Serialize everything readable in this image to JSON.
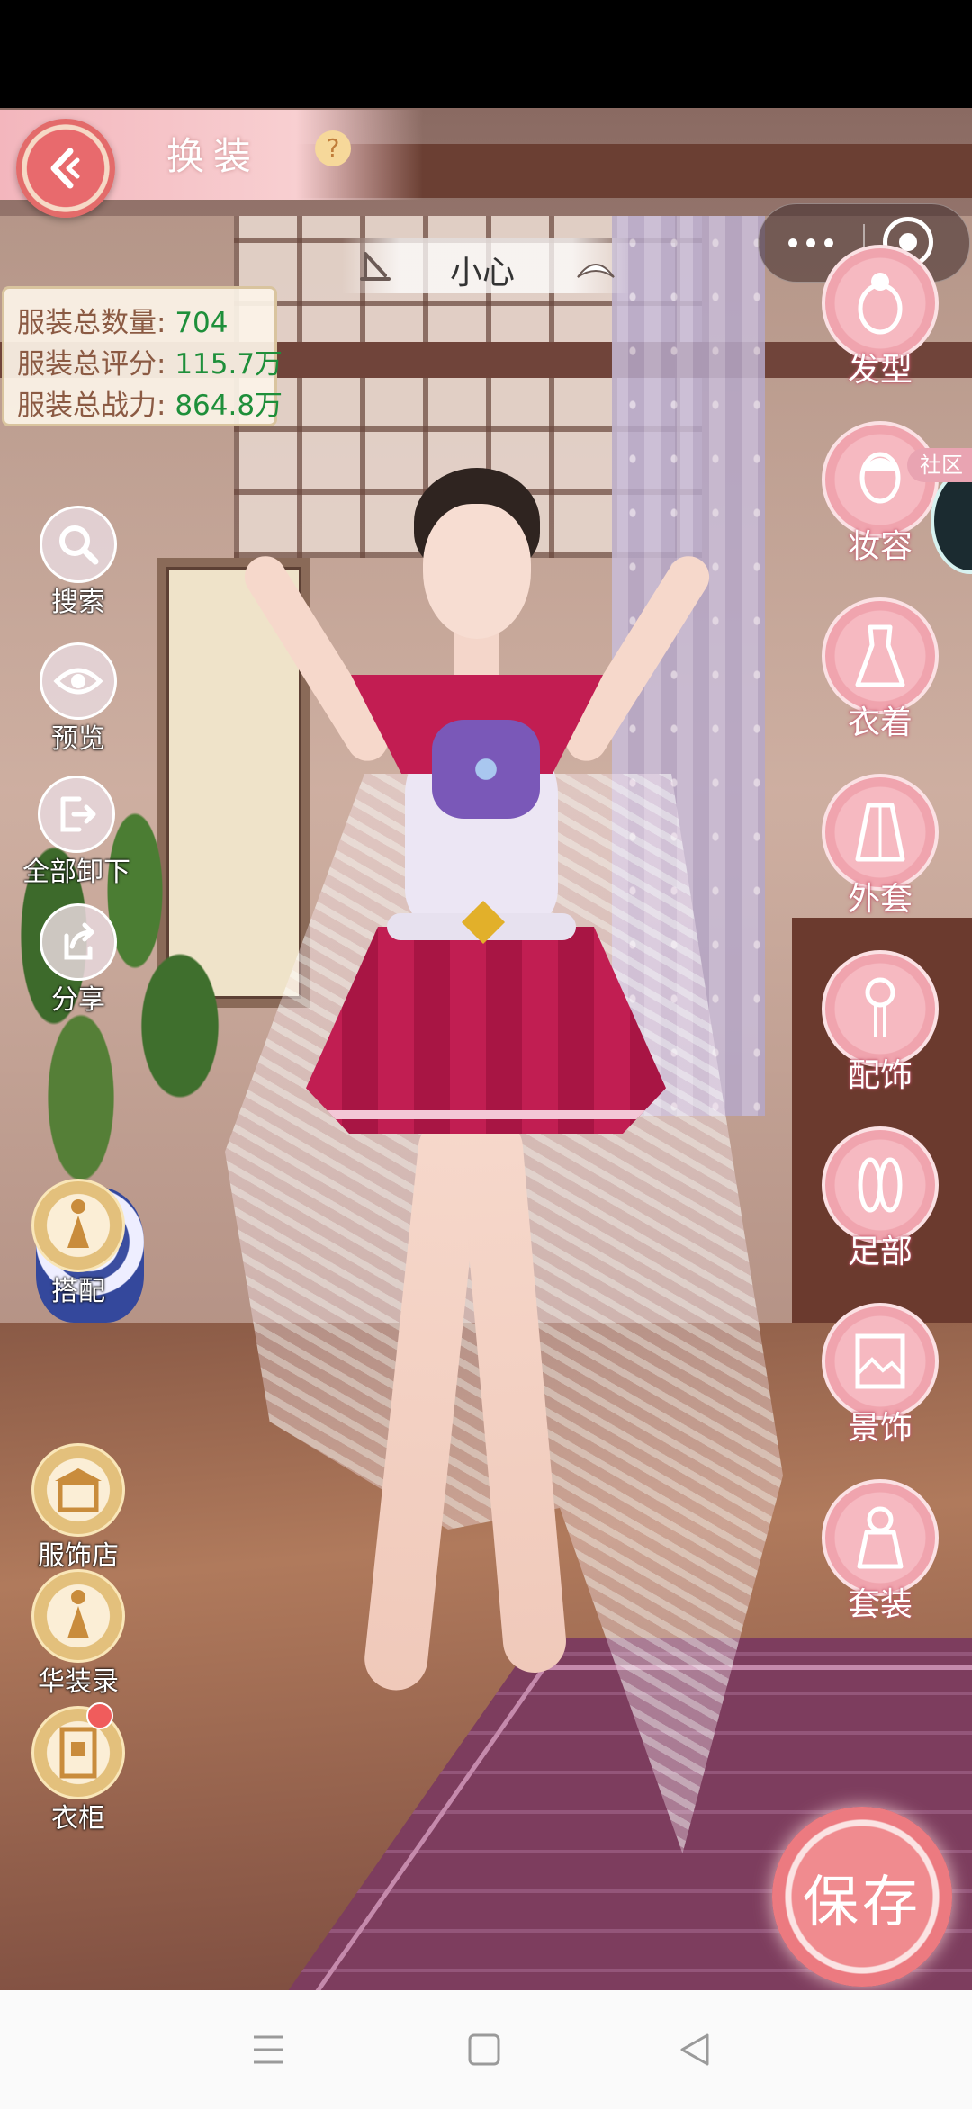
{
  "header": {
    "title": "换装",
    "help": "?"
  },
  "outfit": {
    "name": "小心"
  },
  "stats": [
    {
      "label": "服装总数量:",
      "value": "704"
    },
    {
      "label": "服装总评分:",
      "value": "115.7万"
    },
    {
      "label": "服装总战力:",
      "value": "864.8万"
    }
  ],
  "tools": {
    "search": "搜索",
    "preview": "预览",
    "unequip_all": "全部卸下",
    "share": "分享",
    "match": "搭配",
    "shop": "服饰店",
    "album": "华装录",
    "wardrobe": "衣柜"
  },
  "categories": {
    "hair": "发型",
    "makeup": "妆容",
    "clothing": "衣着",
    "coat": "外套",
    "accessory": "配饰",
    "feet": "足部",
    "scene": "景饰",
    "set": "套装"
  },
  "community": "社区",
  "save": "保存",
  "colors": {
    "accent": "#f0a4ae",
    "stat_value": "#1e8f3a",
    "stat_label": "#8b5a43"
  }
}
